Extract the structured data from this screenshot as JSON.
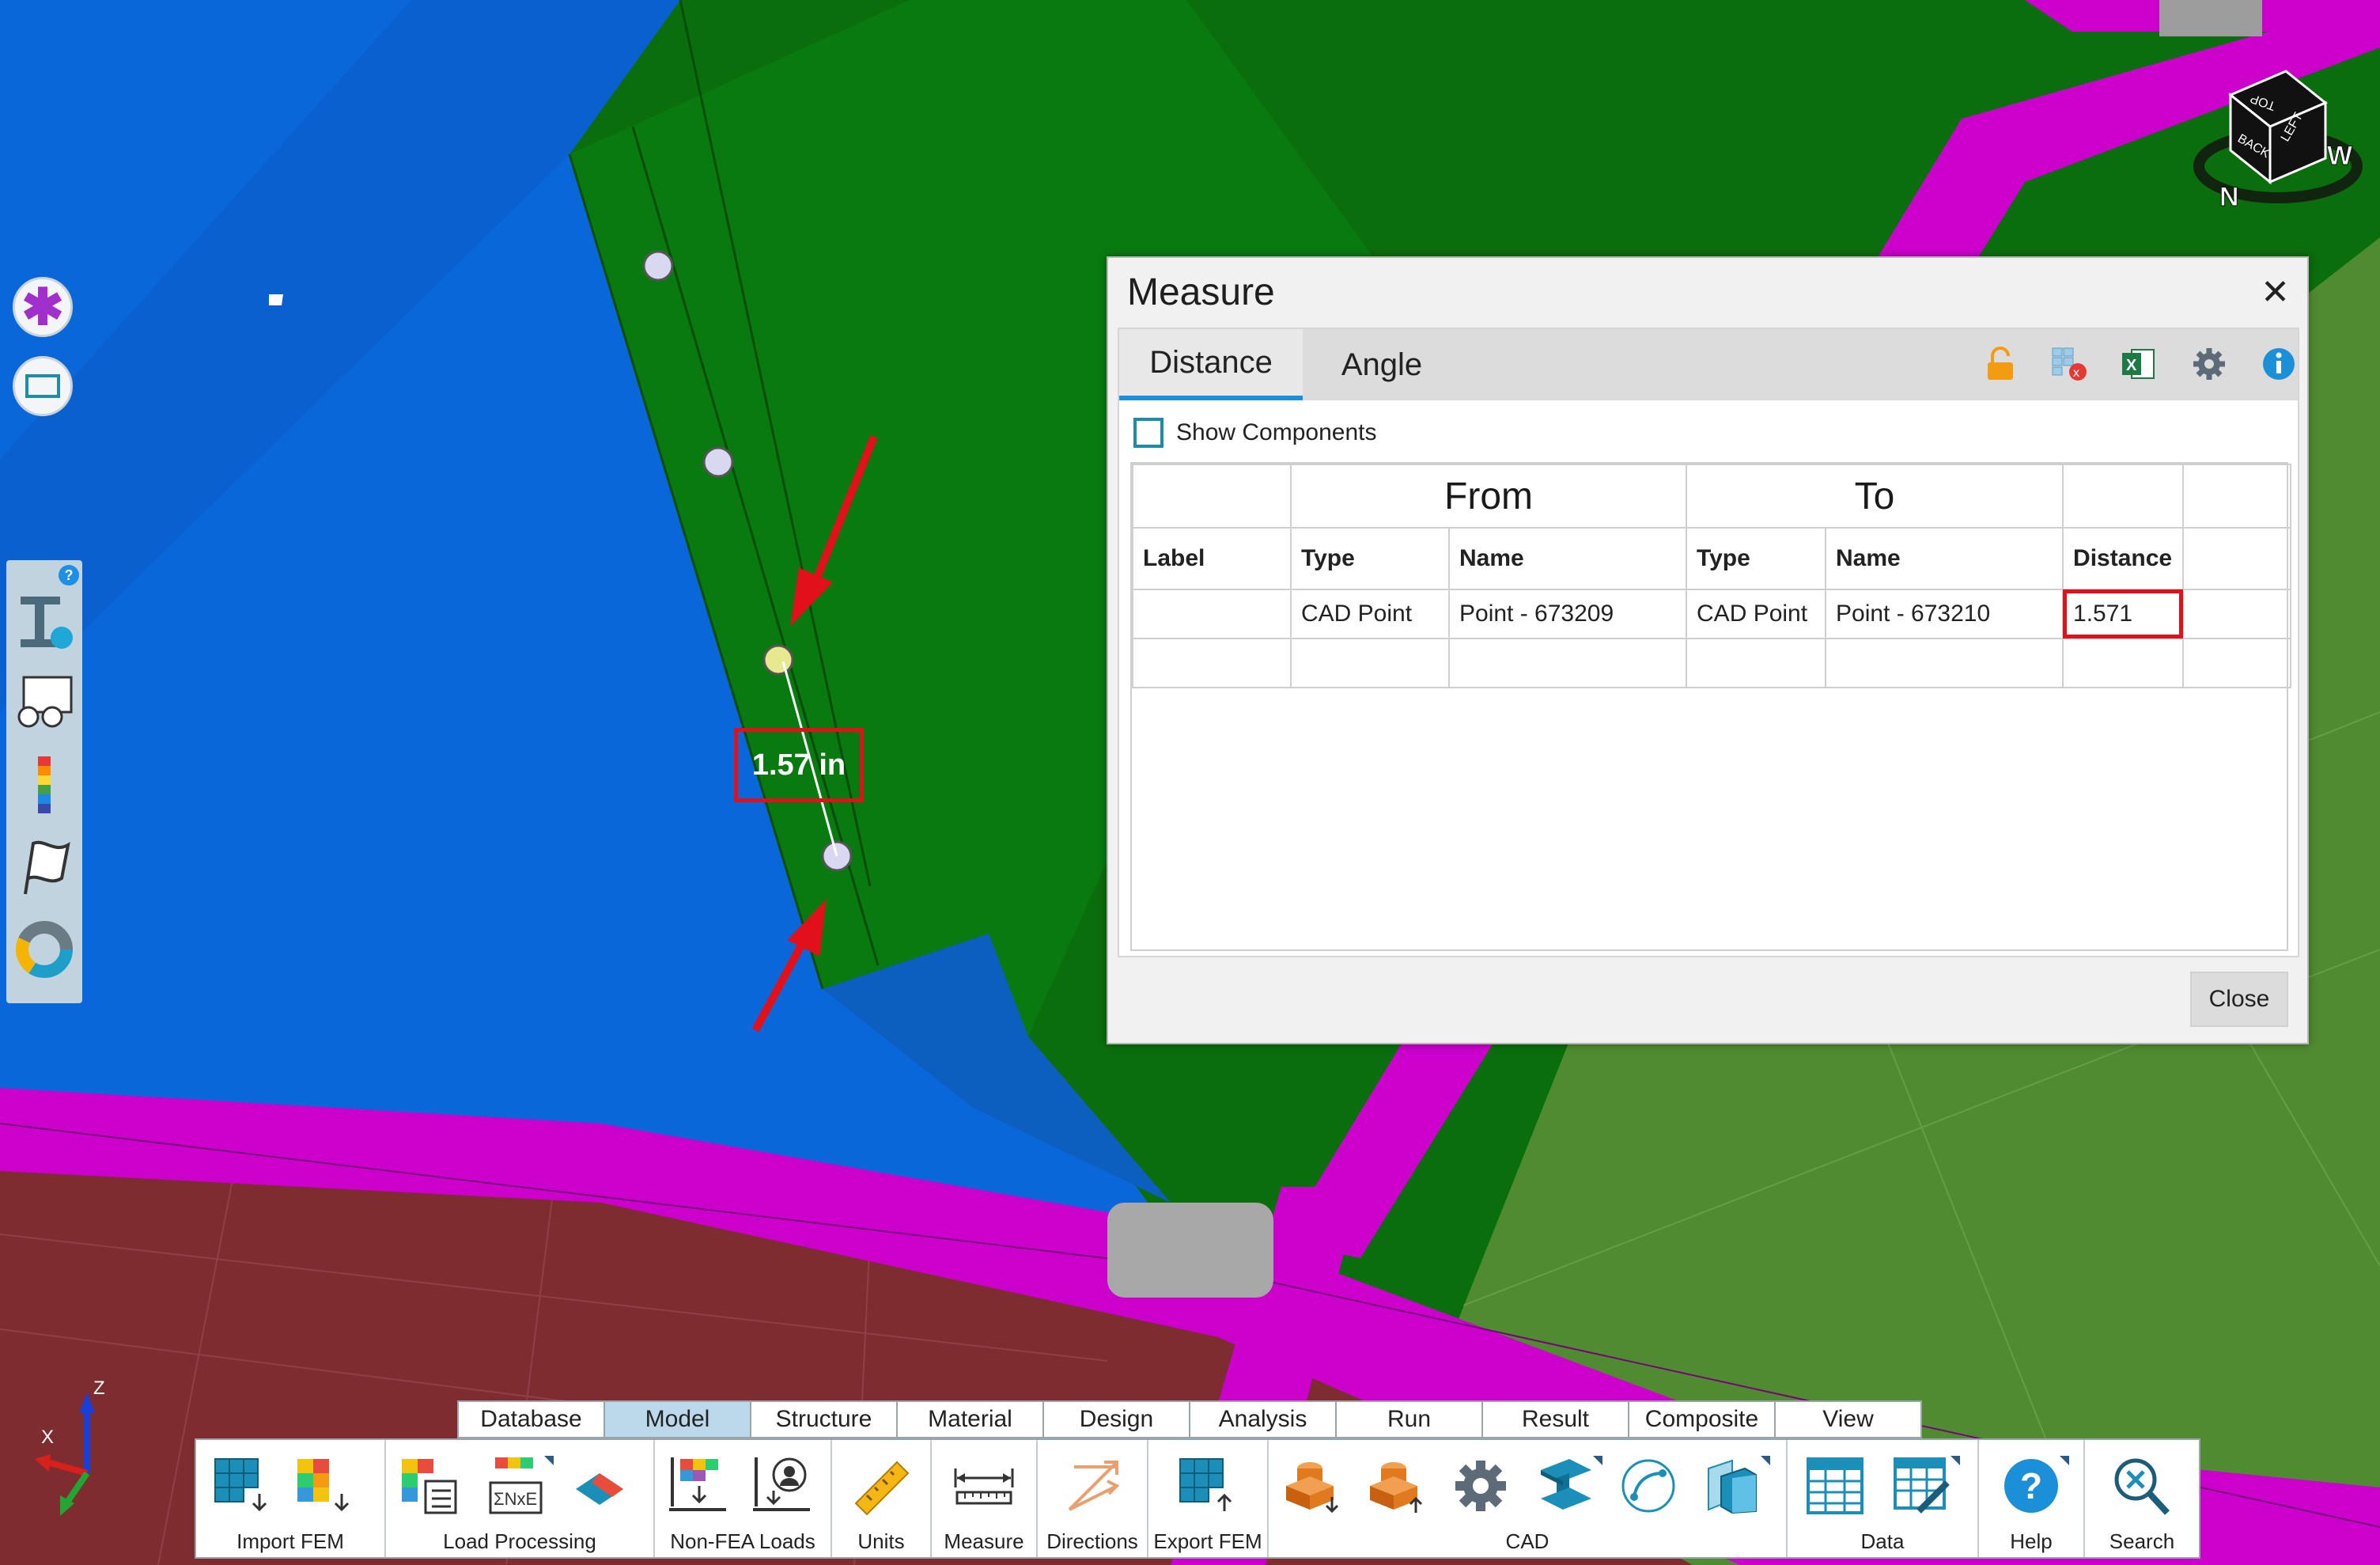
{
  "viewport": {
    "measurement_label": "1.57 in",
    "colors": {
      "green_part": "#0b6e0c",
      "blue_part": "#0a67d9",
      "magenta_frame": "#cc00cc",
      "red_skin": "#7e2b2b",
      "highlight": "#e0111b"
    }
  },
  "view_cube": {
    "faces": [
      "TOP",
      "BACK",
      "LEFT"
    ],
    "compass": [
      "N",
      "W"
    ]
  },
  "left_tools": {
    "help": "?"
  },
  "measure_dialog": {
    "title": "Measure",
    "tabs": [
      "Distance",
      "Angle"
    ],
    "active_tab": "Distance",
    "toolbar_icons": [
      "unlock-icon",
      "clear-table-icon",
      "excel-export-icon",
      "settings-gear-icon",
      "info-icon"
    ],
    "show_components_label": "Show Components",
    "group_headers": {
      "from": "From",
      "to": "To"
    },
    "columns": [
      "Label",
      "Type",
      "Name",
      "Type",
      "Name",
      "Distance"
    ],
    "rows": [
      {
        "label": "",
        "from_type": "CAD Point",
        "from_name": "Point - 673209",
        "to_type": "CAD Point",
        "to_name": "Point - 673210",
        "distance": "1.571"
      }
    ],
    "close_button": "Close"
  },
  "triad": {
    "x": "X",
    "z": "Z"
  },
  "ribbon": {
    "tabs": [
      "Database",
      "Model",
      "Structure",
      "Material",
      "Design",
      "Analysis",
      "Run",
      "Result",
      "Composite",
      "View"
    ],
    "active_tab": "Model",
    "groups": [
      "Import FEM",
      "Load Processing",
      "Non-FEA Loads",
      "Units",
      "Measure",
      "Directions",
      "Export FEM",
      "CAD",
      "Data",
      "Help",
      "Search"
    ]
  }
}
